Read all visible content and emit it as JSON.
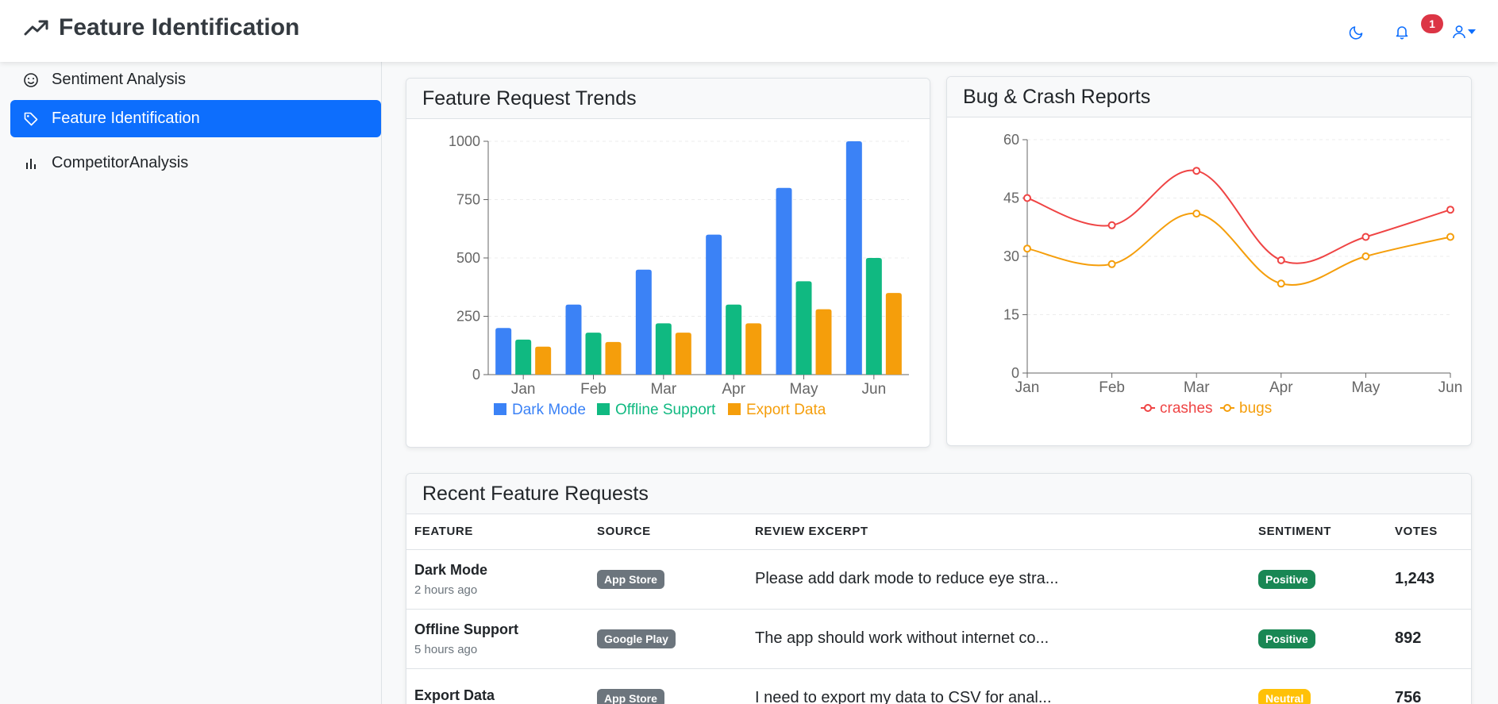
{
  "header": {
    "title": "Feature Identification",
    "notification_count": "1"
  },
  "sidebar": {
    "items": [
      {
        "label": "Sentiment Analysis",
        "icon": "smile-icon"
      },
      {
        "label": "Feature Identification",
        "icon": "tag-icon",
        "active": true
      },
      {
        "label": "CompetitorAnalysis",
        "icon": "bar-chart-icon"
      }
    ]
  },
  "colors": {
    "accent": "#0d6efd",
    "dark_mode": "#3b82f6",
    "offline_support": "#10b981",
    "export_data": "#f59e0b",
    "crashes": "#ef4444",
    "bugs": "#f59e0b"
  },
  "feature_card": {
    "title": "Feature Request Trends"
  },
  "bug_card": {
    "title": "Bug & Crash Reports"
  },
  "chart_data": [
    {
      "type": "bar",
      "categories": [
        "Jan",
        "Feb",
        "Mar",
        "Apr",
        "May",
        "Jun"
      ],
      "series": [
        {
          "name": "Dark Mode",
          "values": [
            200,
            300,
            450,
            600,
            800,
            1000
          ]
        },
        {
          "name": "Offline Support",
          "values": [
            150,
            180,
            220,
            300,
            400,
            500
          ]
        },
        {
          "name": "Export Data",
          "values": [
            120,
            140,
            180,
            220,
            280,
            350
          ]
        }
      ],
      "title": "Feature Request Trends",
      "ylim": [
        0,
        1000
      ],
      "yticks": [
        0,
        250,
        500,
        750,
        1000
      ],
      "legend": "bottom",
      "grid": true
    },
    {
      "type": "line",
      "categories": [
        "Jan",
        "Feb",
        "Mar",
        "Apr",
        "May",
        "Jun"
      ],
      "series": [
        {
          "name": "crashes",
          "values": [
            45,
            38,
            52,
            29,
            35,
            42
          ]
        },
        {
          "name": "bugs",
          "values": [
            32,
            28,
            41,
            23,
            30,
            35
          ]
        }
      ],
      "title": "Bug & Crash Reports",
      "ylim": [
        0,
        60
      ],
      "yticks": [
        0,
        15,
        30,
        45,
        60
      ],
      "legend": "bottom",
      "grid": true
    }
  ],
  "requests": {
    "title": "Recent Feature Requests",
    "columns": [
      "FEATURE",
      "SOURCE",
      "REVIEW EXCERPT",
      "SENTIMENT",
      "VOTES"
    ],
    "rows": [
      {
        "feature": "Dark Mode",
        "time": "2 hours ago",
        "source": "App Store",
        "excerpt": "Please add dark mode to reduce eye stra...",
        "sentiment": "Positive",
        "votes": "1,243"
      },
      {
        "feature": "Offline Support",
        "time": "5 hours ago",
        "source": "Google Play",
        "excerpt": "The app should work without internet co...",
        "sentiment": "Positive",
        "votes": "892"
      },
      {
        "feature": "Export Data",
        "time": "",
        "source": "App Store",
        "excerpt": "I need to export my data to CSV for anal...",
        "sentiment": "Neutral",
        "votes": "756"
      }
    ]
  }
}
